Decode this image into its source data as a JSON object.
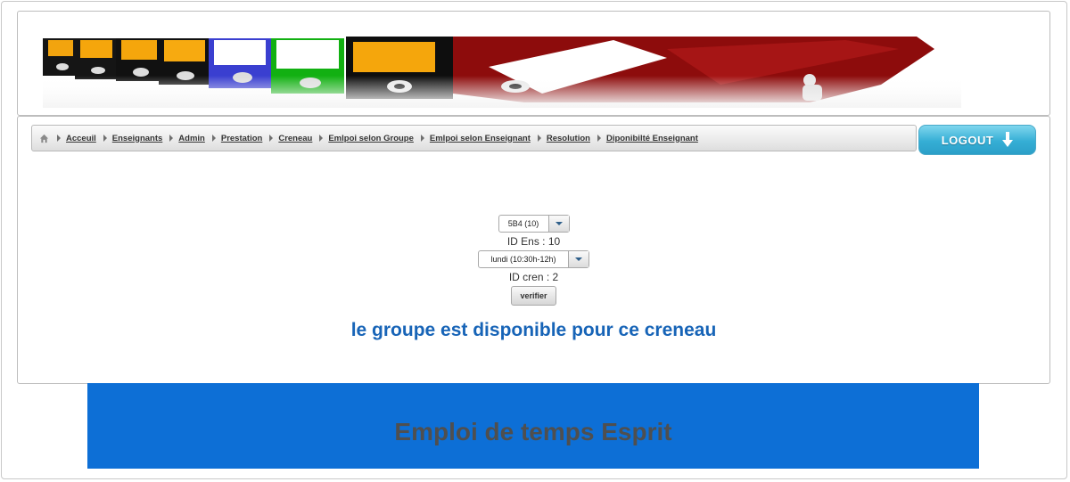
{
  "colors": {
    "footer_bg": "#0d6fd6",
    "result_text": "#1764b7",
    "logout_bg": "#35aed5"
  },
  "banner": {
    "image": "banner-binders-image"
  },
  "breadcrumb": {
    "home_icon": "home-icon",
    "items": [
      {
        "label": "Acceuil"
      },
      {
        "label": "Enseignants"
      },
      {
        "label": "Admin"
      },
      {
        "label": "Prestation"
      },
      {
        "label": "Creneau"
      },
      {
        "label": "Emlpoi selon Groupe"
      },
      {
        "label": "Emlpoi selon Enseignant"
      },
      {
        "label": "Resolution"
      },
      {
        "label": "Diponibilté Enseignant"
      }
    ]
  },
  "logout": {
    "label": "LOGOUT",
    "icon": "down-arrow-icon"
  },
  "form": {
    "group_select": {
      "value": "5B4 (10)"
    },
    "id_ens_label": "ID Ens : 10",
    "creneau_select": {
      "value": "lundi (10:30h-12h)"
    },
    "id_cren_label": "ID cren : 2",
    "verify_button": "verifier"
  },
  "result_message": "le groupe est disponible pour ce creneau",
  "footer": {
    "title": "Emploi de temps Esprit"
  }
}
